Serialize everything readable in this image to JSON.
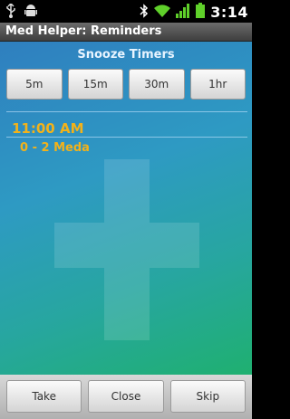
{
  "status_bar": {
    "time": "3:14",
    "icons": [
      "usb-icon",
      "android-debug-icon",
      "bluetooth-icon",
      "wifi-icon",
      "signal-icon",
      "battery-icon"
    ]
  },
  "app": {
    "title": "Med Helper: Reminders"
  },
  "snooze": {
    "title": "Snooze Timers",
    "buttons": [
      "5m",
      "15m",
      "30m",
      "1hr"
    ]
  },
  "reminder": {
    "time": "11:00 AM",
    "medication": "0 - 2 Meda"
  },
  "actions": {
    "take": "Take",
    "close": "Close",
    "skip": "Skip"
  },
  "colors": {
    "accent_text": "#f2b21a",
    "background_top": "#2f7fbf",
    "background_bottom": "#1fb070"
  }
}
